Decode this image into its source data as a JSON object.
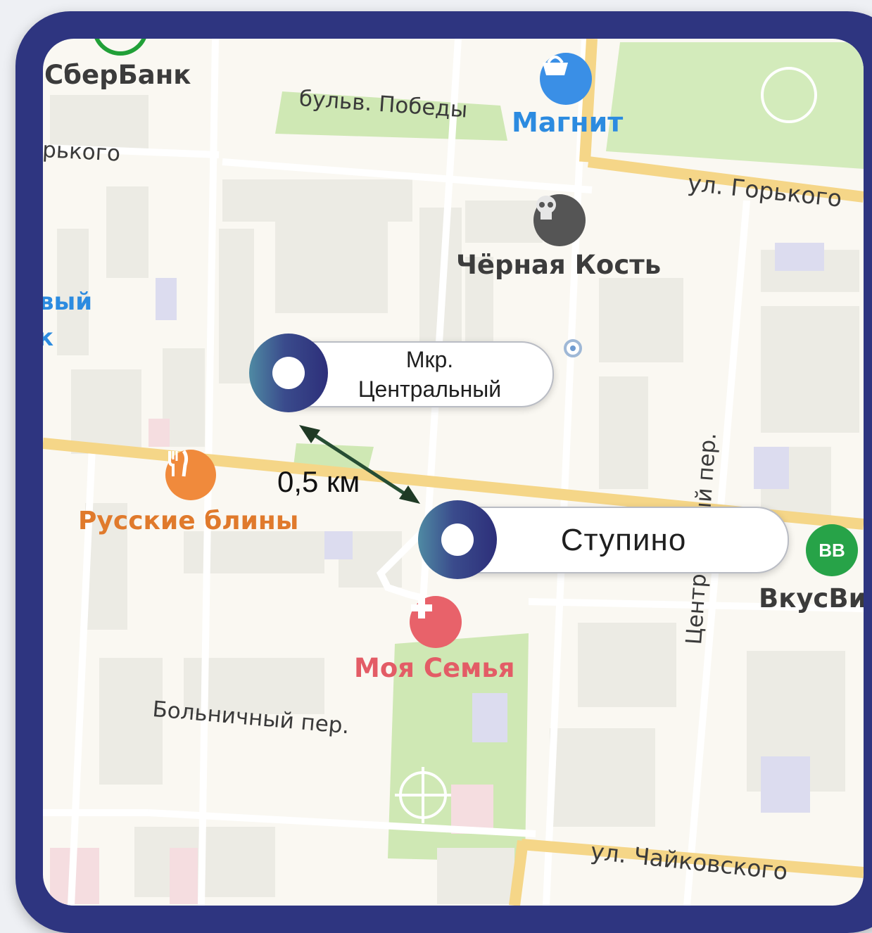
{
  "map": {
    "poi": {
      "sberbank": "СберБанк",
      "magnit": "Магнит",
      "black_bone": "Чёрная Кость",
      "russian_pancakes": "Русские блины",
      "my_family": "Моя Семья",
      "vkusvill": "ВкусВи",
      "vkusvill_badge": "ВВ"
    },
    "streets": {
      "pobedy_blvd": "бульв. Победы",
      "gorkogo_left": "рького",
      "gorkogo_right": "ул. Горького",
      "central_lane": "Центральный пер.",
      "bolnichny_lane": "Больничный пер.",
      "chaikovskogo": "ул. Чайковского",
      "partial_left_1": "вый",
      "partial_left_2": "к"
    },
    "markers": {
      "central": "Мкр.\nЦентральный",
      "stupino": "Ступино"
    },
    "distance": "0,5 км"
  },
  "colors": {
    "frame": "#2e3580",
    "major_road": "#f7d98a",
    "park": "#cfe8b4",
    "building": "#eceae2",
    "sber": "#21a038",
    "magnit": "#2c8be0",
    "restaurant": "#f08a3c",
    "clinic": "#e8626a",
    "vkusvill": "#27a348"
  }
}
